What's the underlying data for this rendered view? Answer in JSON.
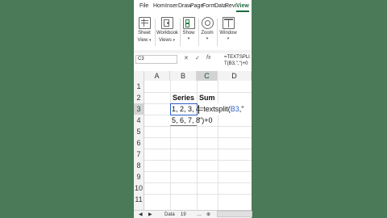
{
  "ribbon_tabs": [
    "File",
    "Hom",
    "Inser",
    "Draw",
    "Page",
    "Form",
    "Data",
    "Revi",
    "View"
  ],
  "active_tab": "View",
  "ribbon_buttons": [
    {
      "line1": "Sheet",
      "line2": "View",
      "icon": "sheet-view-icon"
    },
    {
      "line1": "Workbook",
      "line2": "Views",
      "icon": "workbook-views-icon"
    },
    {
      "line1": "Show",
      "line2": "",
      "icon": "show-icon"
    },
    {
      "line1": "Zoom",
      "line2": "",
      "icon": "zoom-icon"
    },
    {
      "line1": "Window",
      "line2": "",
      "icon": "window-icon"
    }
  ],
  "formula_bar": {
    "name_box": "C3",
    "cancel_glyph": "✕",
    "enter_glyph": "✓",
    "fx_label": "fx",
    "formula": "=TEXTSPLIT(B3,\",\")+0"
  },
  "columns": [
    "A",
    "B",
    "C",
    "D"
  ],
  "rows": [
    "1",
    "2",
    "3",
    "4",
    "5",
    "6",
    "7",
    "8",
    "9",
    "10",
    "11"
  ],
  "cells": {
    "b2": "Series",
    "c2": "Sum",
    "b3": "1, 2, 3, 4",
    "c3_eq": "=textsplit(",
    "c3_ref": "B3",
    "c3_rest": ",\"",
    "b4": "5, 6, 7, 8",
    "c4": "\")+0"
  },
  "sheet_tabs": [
    "Data",
    "19"
  ],
  "colors": {
    "background": "#4a7a57",
    "accent": "#1d6b3c",
    "reference": "#2f5fc9"
  }
}
